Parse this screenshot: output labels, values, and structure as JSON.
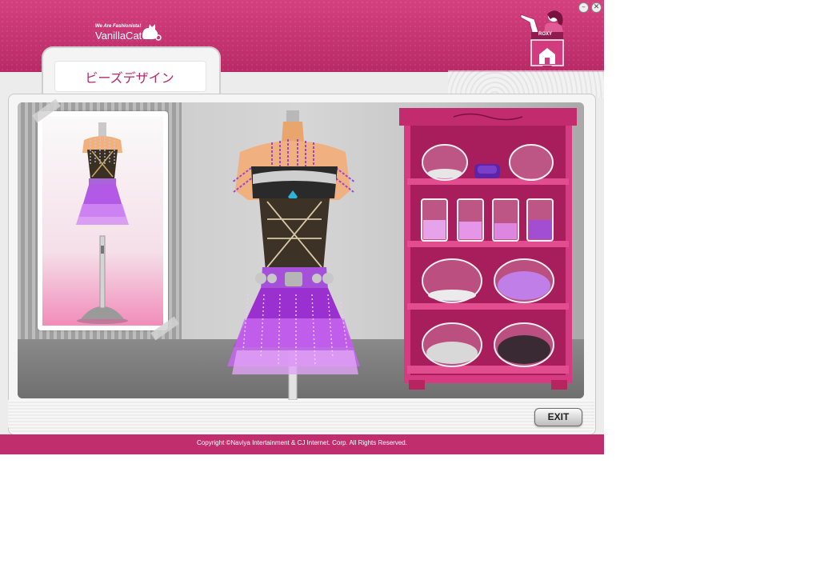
{
  "header": {
    "tagline": "We Are Fashionista!",
    "brand": "VanillaCat",
    "roxy_label": "ROXY"
  },
  "window_controls": {
    "minimize": "–",
    "close": "✕"
  },
  "tab": {
    "title": "ビーズデザイン"
  },
  "exit_button": {
    "label": "EXIT"
  },
  "footer": {
    "copyright": "Copyright ©Naviya Intertainment & CJ Internet. Corp. All Rights Reserved."
  },
  "icons": [
    "cat-icon",
    "minimize-icon",
    "close-icon",
    "roxy-shop-icon"
  ],
  "colors": {
    "brand_pink": "#c02e6d",
    "title_pink": "#b32a6b",
    "dress_purple": "#9b30d0",
    "shelf_pink": "#d63a80"
  },
  "shelf": {
    "rows": [
      [
        "white-pearl-bowl",
        "purple-cushion",
        "empty-bowl"
      ],
      [
        "pink-bead-jar",
        "pink-bead-jar",
        "pink-bead-jar",
        "purple-bead-jar"
      ],
      [
        "white-pearl-bowl",
        "lavender-bead-bowl"
      ],
      [
        "silver-bead-bowl",
        "black-bead-bowl"
      ]
    ]
  }
}
